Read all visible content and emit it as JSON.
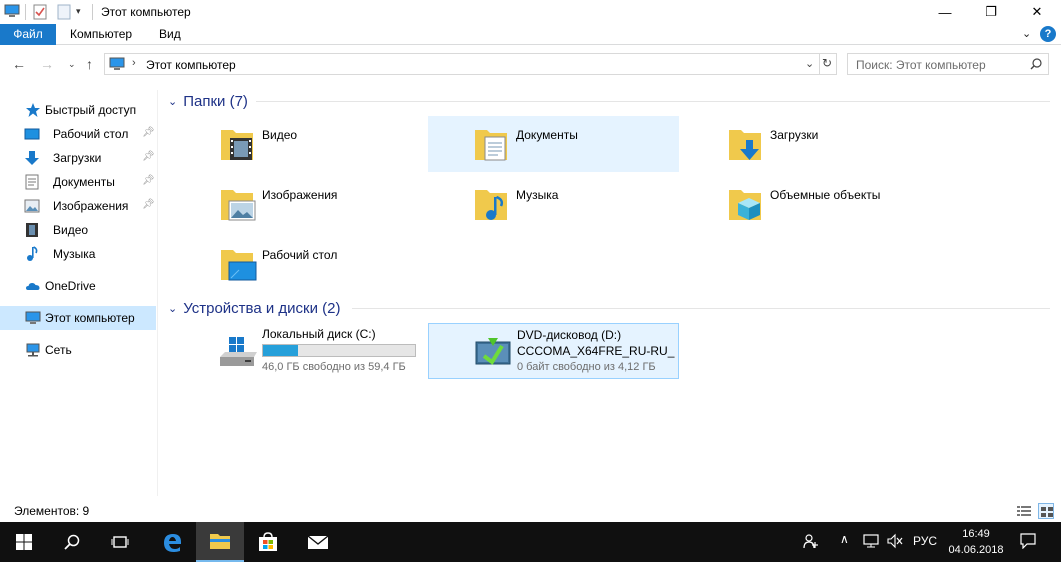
{
  "window": {
    "title": "Этот компьютер",
    "minimize_glyph": "—",
    "maximize_glyph": "❐",
    "close_glyph": "✕"
  },
  "ribbon": {
    "tabs": [
      "Файл",
      "Компьютер",
      "Вид"
    ],
    "accent": "#1979ca"
  },
  "address": {
    "path": "Этот компьютер",
    "search_placeholder": "Поиск: Этот компьютер"
  },
  "sidebar": {
    "quick_access": "Быстрый доступ",
    "pinned": [
      "Рабочий стол",
      "Загрузки",
      "Документы",
      "Изображения"
    ],
    "unpinned": [
      "Видео",
      "Музыка"
    ],
    "onedrive": "OneDrive",
    "this_pc": "Этот компьютер",
    "network": "Сеть"
  },
  "folders": {
    "header": "Папки (7)",
    "items": [
      "Видео",
      "Документы",
      "Загрузки",
      "Изображения",
      "Музыка",
      "Объемные объекты",
      "Рабочий стол"
    ]
  },
  "drives": {
    "header": "Устройства и диски (2)",
    "local": {
      "name": "Локальный диск (C:)",
      "free": "46,0 ГБ свободно из 59,4 ГБ",
      "used_fraction": 0.23
    },
    "dvd": {
      "name": "DVD-дисковод (D:)",
      "label": "CCCOMA_X64FRE_RU-RU_",
      "free": "0 байт свободно из 4,12 ГБ"
    }
  },
  "status": {
    "items": "Элементов: 9"
  },
  "taskbar": {
    "language": "РУС",
    "time": "16:49",
    "date": "04.06.2018"
  }
}
